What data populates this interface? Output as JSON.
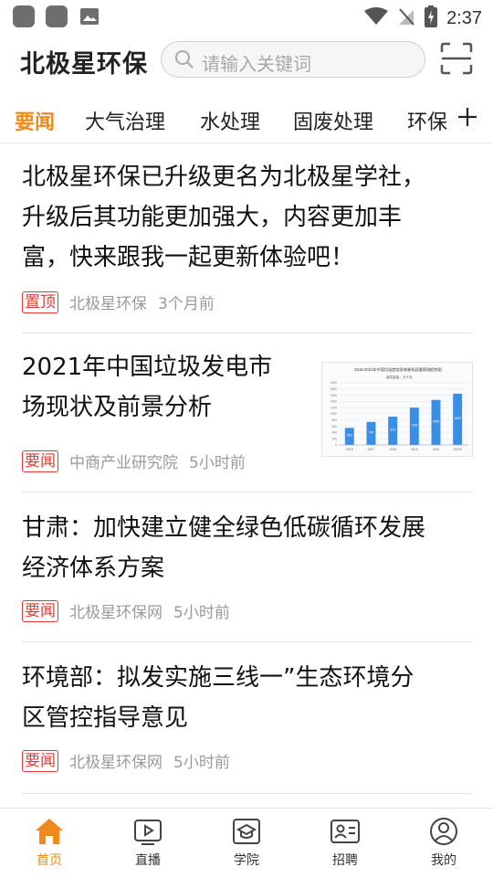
{
  "status_bar": {
    "time": "2:37"
  },
  "header": {
    "logo": "北极星环保",
    "search_placeholder": "请输入关键词"
  },
  "tabs": [
    {
      "label": "要闻",
      "active": true
    },
    {
      "label": "大气治理"
    },
    {
      "label": "水处理"
    },
    {
      "label": "固废处理"
    },
    {
      "label": "环保"
    }
  ],
  "articles": [
    {
      "title_lines": [
        "北极星环保已升级更名为北极星学社，",
        "升级后其功能更加强大，内容更加丰",
        "富，快来跟我一起更新体验吧！"
      ],
      "tag": "置顶",
      "source": "北极星环保",
      "time": "3个月前"
    },
    {
      "title_lines": [
        "2021年中国垃圾发电市",
        "场现状及前景分析"
      ],
      "tag": "要闻",
      "source": "中商产业研究院",
      "time": "5小时前",
      "thumbnail": {
        "title": "2016-2021年中国垃圾焚烧发电装机容量预测趋势图",
        "legend": "装机容量：万千瓦",
        "type": "bar",
        "categories": [
          "2016",
          "2017",
          "2018",
          "2019",
          "2020",
          "2021E"
        ],
        "values": [
          550,
          740,
          910,
          1200,
          1450,
          1650
        ],
        "ylim": [
          0,
          2000
        ],
        "color": "#3a8ee6"
      }
    },
    {
      "title_lines": [
        "甘肃：加快建立健全绿色低碳循环发展",
        "经济体系方案"
      ],
      "tag": "要闻",
      "source": "北极星环保网",
      "time": "5小时前"
    },
    {
      "title_lines": [
        "环境部：拟发实施三线一”生态环境分",
        "区管控指导意见"
      ],
      "tag": "要闻",
      "source": "北极星环保网",
      "time": "5小时前"
    }
  ],
  "bottom_nav": [
    {
      "label": "首页",
      "icon": "home-icon",
      "active": true
    },
    {
      "label": "直播",
      "icon": "play-icon"
    },
    {
      "label": "学院",
      "icon": "graduation-cap-icon"
    },
    {
      "label": "招聘",
      "icon": "id-card-icon"
    },
    {
      "label": "我的",
      "icon": "user-icon"
    }
  ],
  "colors": {
    "accent": "#f08a1c",
    "tag": "#e53935",
    "meta": "#9a9a9a"
  }
}
